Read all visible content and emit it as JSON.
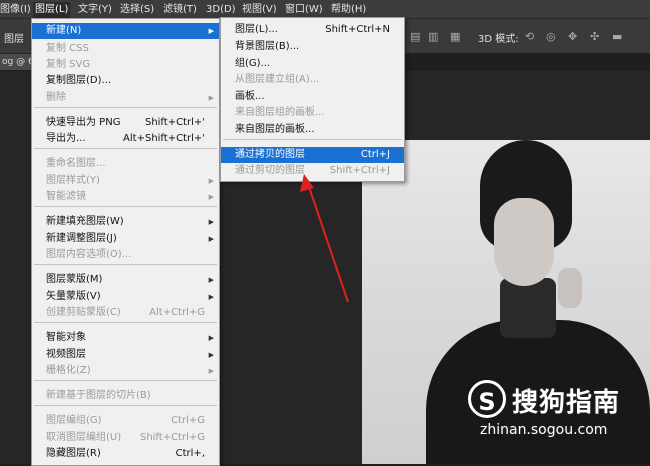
{
  "menubar": {
    "items": [
      "图像(I)",
      "图层(L)",
      "文字(Y)",
      "选择(S)",
      "滤镜(T)",
      "3D(D)",
      "视图(V)",
      "窗口(W)",
      "帮助(H)"
    ]
  },
  "options_bar": {
    "left_label": "图层",
    "mode_label": "3D 模式:"
  },
  "tab": {
    "label": "og @ 6"
  },
  "layer_menu": {
    "items": [
      {
        "label": "新建(N)",
        "shortcut": "",
        "submenu": true,
        "disabled": false,
        "highlighted": true
      },
      {
        "label": "复制 CSS",
        "shortcut": "",
        "submenu": false,
        "disabled": true
      },
      {
        "label": "复制 SVG",
        "shortcut": "",
        "submenu": false,
        "disabled": true
      },
      {
        "label": "复制图层(D)...",
        "shortcut": "",
        "submenu": false,
        "disabled": false
      },
      {
        "label": "删除",
        "shortcut": "",
        "submenu": true,
        "disabled": true
      },
      {
        "label": "快速导出为 PNG",
        "shortcut": "Shift+Ctrl+'",
        "submenu": false,
        "disabled": false
      },
      {
        "label": "导出为...",
        "shortcut": "Alt+Shift+Ctrl+'",
        "submenu": false,
        "disabled": false
      },
      {
        "label": "重命名图层...",
        "shortcut": "",
        "submenu": false,
        "disabled": true
      },
      {
        "label": "图层样式(Y)",
        "shortcut": "",
        "submenu": true,
        "disabled": true
      },
      {
        "label": "智能滤镜",
        "shortcut": "",
        "submenu": true,
        "disabled": true
      },
      {
        "label": "新建填充图层(W)",
        "shortcut": "",
        "submenu": true,
        "disabled": false
      },
      {
        "label": "新建调整图层(J)",
        "shortcut": "",
        "submenu": true,
        "disabled": false
      },
      {
        "label": "图层内容选项(O)...",
        "shortcut": "",
        "submenu": false,
        "disabled": true
      },
      {
        "label": "图层蒙版(M)",
        "shortcut": "",
        "submenu": true,
        "disabled": false
      },
      {
        "label": "矢量蒙版(V)",
        "shortcut": "",
        "submenu": true,
        "disabled": false
      },
      {
        "label": "创建剪贴蒙版(C)",
        "shortcut": "Alt+Ctrl+G",
        "submenu": false,
        "disabled": true
      },
      {
        "label": "智能对象",
        "shortcut": "",
        "submenu": true,
        "disabled": false
      },
      {
        "label": "视频图层",
        "shortcut": "",
        "submenu": true,
        "disabled": false
      },
      {
        "label": "栅格化(Z)",
        "shortcut": "",
        "submenu": true,
        "disabled": true
      },
      {
        "label": "新建基于图层的切片(B)",
        "shortcut": "",
        "submenu": false,
        "disabled": true
      },
      {
        "label": "图层编组(G)",
        "shortcut": "Ctrl+G",
        "submenu": false,
        "disabled": true
      },
      {
        "label": "取消图层编组(U)",
        "shortcut": "Shift+Ctrl+G",
        "submenu": false,
        "disabled": true
      },
      {
        "label": "隐藏图层(R)",
        "shortcut": "Ctrl+,",
        "submenu": false,
        "disabled": false
      }
    ]
  },
  "new_submenu": {
    "items": [
      {
        "label": "图层(L)...",
        "shortcut": "Shift+Ctrl+N",
        "disabled": false,
        "highlighted": false
      },
      {
        "label": "背景图层(B)...",
        "shortcut": "",
        "disabled": false,
        "highlighted": false
      },
      {
        "label": "组(G)...",
        "shortcut": "",
        "disabled": false,
        "highlighted": false
      },
      {
        "label": "从图层建立组(A)...",
        "shortcut": "",
        "disabled": true,
        "highlighted": false
      },
      {
        "label": "画板...",
        "shortcut": "",
        "disabled": false,
        "highlighted": false
      },
      {
        "label": "来自图层组的画板...",
        "shortcut": "",
        "disabled": true,
        "highlighted": false
      },
      {
        "label": "来自图层的画板...",
        "shortcut": "",
        "disabled": false,
        "highlighted": false
      },
      {
        "label": "通过拷贝的图层",
        "shortcut": "Ctrl+J",
        "disabled": false,
        "highlighted": true
      },
      {
        "label": "通过剪切的图层",
        "shortcut": "Shift+Ctrl+J",
        "disabled": true,
        "highlighted": false
      }
    ]
  },
  "watermark": {
    "logo_letter": "S",
    "brand": "搜狗指南",
    "url": "zhinan.sogou.com"
  },
  "colors": {
    "highlight": "#1b70d4",
    "arrow": "#e02020",
    "menu_bg": "#f0f0f0"
  }
}
